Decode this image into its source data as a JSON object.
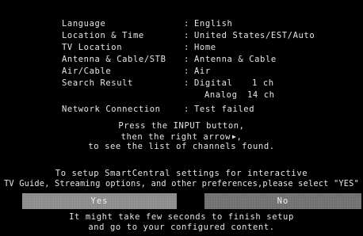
{
  "summary": {
    "rows": [
      {
        "label": "Language",
        "value": "English"
      },
      {
        "label": "Location & Time",
        "value": "United States/EST/Auto"
      },
      {
        "label": "TV Location",
        "value": "Home"
      },
      {
        "label": "Antenna & Cable/STB",
        "value": "Antenna & Cable"
      },
      {
        "label": "Air/Cable",
        "value": "Air"
      }
    ],
    "search_result": {
      "label": "Search Result",
      "digital_label": "Digital",
      "digital_count": "1 ch",
      "analog_label": "Analog",
      "analog_count": "14 ch"
    },
    "network": {
      "label": "Network Connection",
      "value": "Test failed"
    },
    "colon": ":"
  },
  "instructions": {
    "line1": "Press the INPUT button,",
    "line2": "then the right arrow",
    "arrow_glyph": "▶",
    "line2_end": ",",
    "line3": "to see the list of channels found."
  },
  "smartcentral": {
    "line1": "To setup SmartCentral settings for interactive",
    "line2": "TV Guide, Streaming options, and other preferences,please select \"YES\""
  },
  "buttons": {
    "yes_label": "Yes",
    "no_label": "No"
  },
  "footer": {
    "line1": "It might take few seconds to finish setup",
    "line2": "and go to your configured content."
  }
}
